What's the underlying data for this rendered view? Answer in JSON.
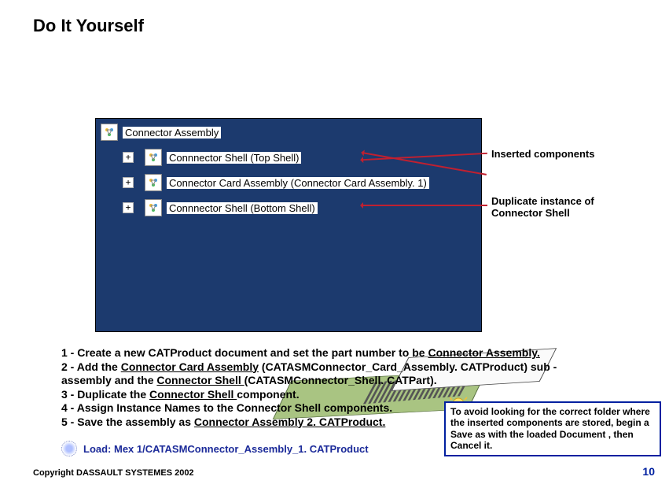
{
  "title": "Do It Yourself",
  "tree": {
    "root": "Connector Assembly",
    "children": [
      "Connnector Shell (Top Shell)",
      "Connector Card Assembly (Connector Card Assembly. 1)",
      "Connnector Shell (Bottom Shell)"
    ]
  },
  "annotations": {
    "inserted": "Inserted components",
    "duplicate": "Duplicate instance of Connector Shell"
  },
  "instructions": [
    {
      "pre": "1 - Create a new CATProduct document and set the part number to be ",
      "ul": "Connector Assembly.",
      "post": ""
    },
    {
      "pre": "2 - Add the ",
      "ul": "Connector Card Assembly",
      "mid": "  (CATASMConnector_Card_Assembly. CATProduct) sub -assembly and the ",
      "ul2": "Connector Shell ",
      "post": "(CATASMConnector_Shell. CATPart)."
    },
    {
      "pre": "3 - Duplicate the ",
      "ul": "Connector Shell ",
      "post": " component."
    },
    {
      "text": "4 - Assign Instance Names to the Connector Shell components."
    },
    {
      "pre": "5 - Save the assembly as ",
      "ul": "Connector Assembly 2. CATProduct.",
      "post": ""
    }
  ],
  "load": {
    "text": "Load: Mex 1/CATASMConnector_Assembly_1. CATProduct"
  },
  "tip": {
    "text": "To avoid looking for the correct folder where the inserted components are stored, begin a Save as with the loaded Document , then Cancel it."
  },
  "footer": {
    "copyright": "Copyright DASSAULT SYSTEMES 2002",
    "page": "10"
  }
}
